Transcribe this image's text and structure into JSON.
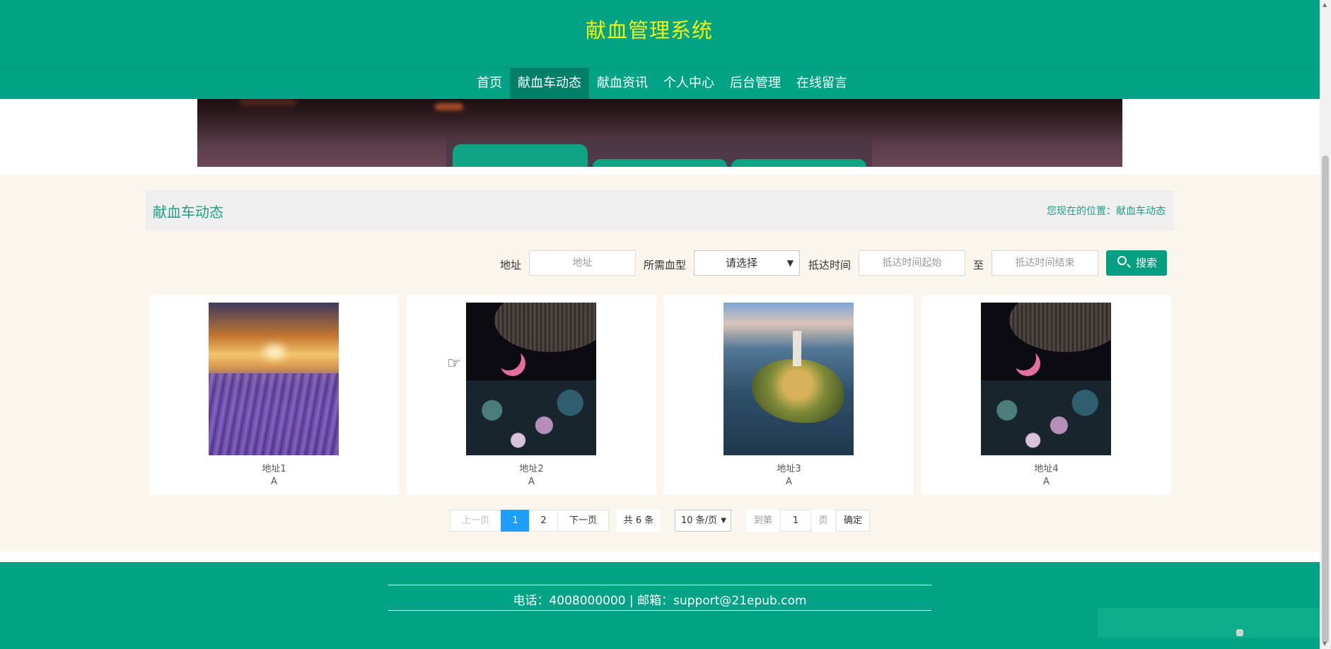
{
  "header": {
    "title": "献血管理系统"
  },
  "nav": {
    "items": [
      {
        "label": "首页"
      },
      {
        "label": "献血车动态",
        "active": true
      },
      {
        "label": "献血资讯"
      },
      {
        "label": "个人中心"
      },
      {
        "label": "后台管理"
      },
      {
        "label": "在线留言"
      }
    ]
  },
  "page": {
    "title": "献血车动态",
    "breadcrumb": "您现在的位置：献血车动态"
  },
  "search": {
    "address_label": "地址",
    "address_placeholder": "地址",
    "blood_type_label": "所需血型",
    "blood_type_value": "请选择",
    "arrival_label": "抵达时间",
    "arrival_start_placeholder": "抵达时间起始",
    "to_label": "至",
    "arrival_end_placeholder": "抵达时间结束",
    "button_label": "搜索"
  },
  "cards": [
    {
      "title": "地址1",
      "blood_type": "A",
      "image": "lavender-field-sunset"
    },
    {
      "title": "地址2",
      "blood_type": "A",
      "image": "night-garden-moon"
    },
    {
      "title": "地址3",
      "blood_type": "A",
      "image": "castle-island-lake"
    },
    {
      "title": "地址4",
      "blood_type": "A",
      "image": "night-garden-moon"
    }
  ],
  "pagination": {
    "prev": "上一页",
    "pages": [
      "1",
      "2"
    ],
    "current": "1",
    "next": "下一页",
    "total": "共 6 条",
    "per_page": "10 条/页",
    "goto_label": "到第",
    "goto_value": "1",
    "page_unit": "页",
    "confirm": "确定"
  },
  "footer": {
    "contact": "电话：4008000000 | 邮箱：support@21epub.com"
  },
  "colors": {
    "primary": "#01a386",
    "title_yellow": "#f3f20b",
    "accent_text": "#1aa184",
    "page_bg": "#faf5ed",
    "page_current": "#1e9fff"
  }
}
